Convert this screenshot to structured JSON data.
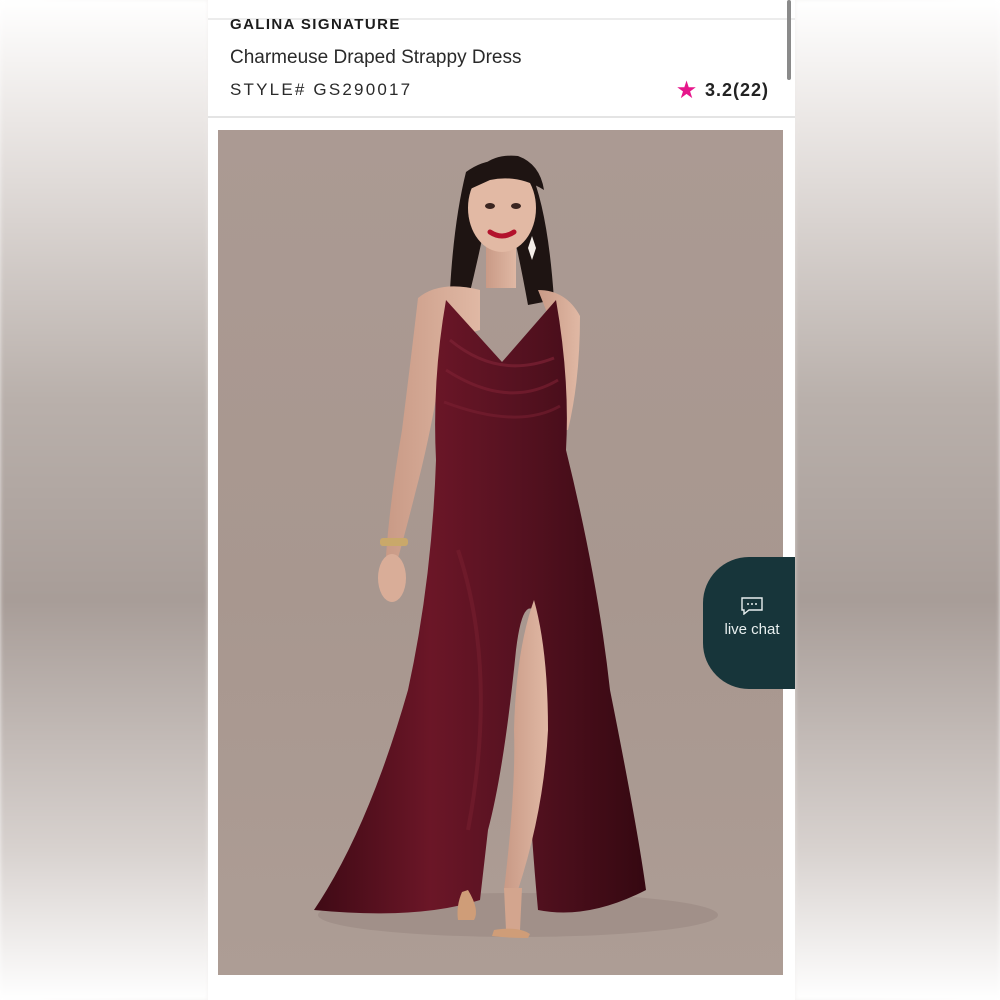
{
  "product": {
    "brand": "GALINA SIGNATURE",
    "name": "Charmeuse Draped Strappy Dress",
    "style": "STYLE# GS290017",
    "rating": "3.2(22)",
    "star_color": "#e6168b"
  },
  "image": {
    "background_color": "#a99890",
    "dress_color": "#5e1422"
  },
  "live_chat": {
    "label": "live chat",
    "icon": "chat-bubble-icon",
    "background": "#17353a"
  }
}
